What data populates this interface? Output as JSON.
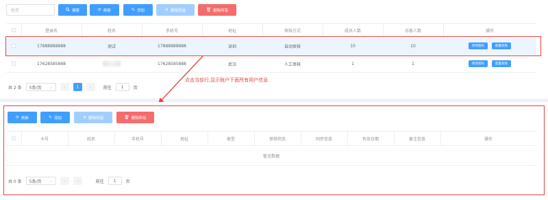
{
  "top": {
    "search_placeholder": "姓名",
    "buttons": {
      "search": "搜索",
      "refresh": "刷新",
      "add": "添加",
      "batch_delete": "删除所选",
      "delete_all": "删除所有"
    },
    "columns": [
      "登录名",
      "姓名",
      "手机号",
      "地址",
      "审核方式",
      "成员人数",
      "访客人数",
      "操作"
    ],
    "rows": [
      {
        "login": "17888888888",
        "name": "测试",
        "phone": "17888888888",
        "address": "深圳",
        "audit": "自动审核",
        "members": "10",
        "visitors": "10"
      },
      {
        "login": "17628585888",
        "name": "",
        "phone": "17628585888",
        "address": "武汉",
        "audit": "人工审核",
        "members": "1",
        "visitors": "1"
      }
    ],
    "row_actions": {
      "edit_password": "修改密码",
      "config_perm": "配置权限"
    },
    "pagination": {
      "total": "共 2 条",
      "page_size": "5条/页",
      "prev": "‹",
      "current": "1",
      "next": "›",
      "goto_label": "前往",
      "goto_value": "1",
      "page_unit": "页"
    }
  },
  "annotation": {
    "text": "点击当前行,显示账户下面所有用户信息",
    "color": "#e0443a"
  },
  "bottom": {
    "buttons": {
      "refresh": "刷新",
      "add": "添加",
      "batch_delete": "删除所选",
      "delete_all": "删除所有"
    },
    "columns": [
      "卡号",
      "姓名",
      "手机号",
      "地址",
      "类型",
      "审核状态",
      "同步信息",
      "有效日期",
      "备注信息",
      "操作"
    ],
    "empty_text": "暂无数据",
    "pagination": {
      "total": "共 0 条",
      "page_size": "5条/页",
      "prev": "‹",
      "next": "›",
      "goto_label": "前往",
      "goto_value": "1",
      "page_unit": "页"
    }
  },
  "colors": {
    "primary": "#409eff",
    "danger": "#f56c6c",
    "highlight": "#e0443a",
    "selected_row": "#ecf5ff"
  },
  "icons": {
    "search": "search-icon",
    "refresh": "refresh-icon",
    "add": "edit-icon",
    "batch_delete": "close-icon",
    "delete_all": "trash-icon"
  }
}
